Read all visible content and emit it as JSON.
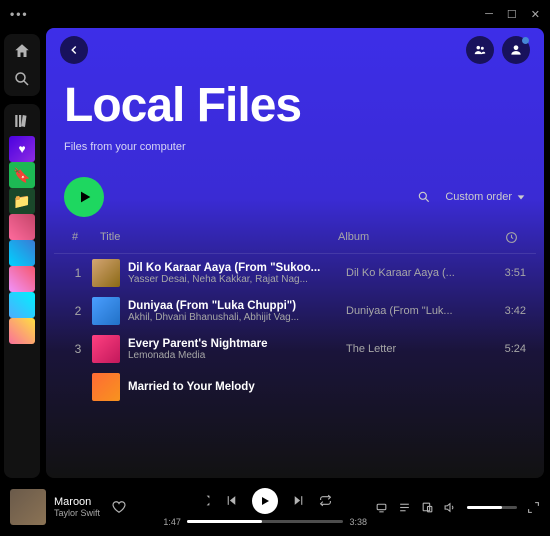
{
  "titlebar": {
    "dots": "•••"
  },
  "header": {
    "title": "Local Files",
    "subtitle": "Files from your computer"
  },
  "sort": {
    "label": "Custom order"
  },
  "columns": {
    "index": "#",
    "title": "Title",
    "album": "Album"
  },
  "tracks": [
    {
      "n": "1",
      "title": "Dil Ko Karaar Aaya (From \"Sukoo...",
      "artist": "Yasser Desai, Neha Kakkar, Rajat Nag...",
      "album": "Dil Ko Karaar Aaya (...",
      "dur": "3:51",
      "art": "linear-gradient(135deg,#d4a574,#8b6914)"
    },
    {
      "n": "2",
      "title": "Duniyaa (From \"Luka Chuppi\")",
      "artist": "Akhil, Dhvani Bhanushali, Abhijit Vag...",
      "album": "Duniyaa (From \"Luk...",
      "dur": "3:42",
      "art": "linear-gradient(135deg,#4a9eff,#2171c7)"
    },
    {
      "n": "3",
      "title": "Every Parent's Nightmare",
      "artist": "Lemonada Media",
      "album": "The Letter",
      "dur": "5:24",
      "art": "linear-gradient(135deg,#ff4081,#c2185b)"
    },
    {
      "n": "",
      "title": "Married to Your Melody",
      "artist": "",
      "album": "",
      "dur": "",
      "art": "linear-gradient(135deg,#ff6b35,#f7931e)"
    }
  ],
  "sidebar_items": [
    "linear-gradient(135deg,#4a00e0,#8e2de2)",
    "#1db954",
    "#1a472a",
    "linear-gradient(45deg,#ff6b9d,#c44569)",
    "linear-gradient(45deg,#00d2ff,#3a7bd5)",
    "linear-gradient(45deg,#f093fb,#f5576c)",
    "linear-gradient(45deg,#4facfe,#00f2fe)",
    "linear-gradient(45deg,#fa709a,#fee140)"
  ],
  "nowplaying": {
    "title": "Maroon",
    "artist": "Taylor Swift",
    "elapsed": "1:47",
    "total": "3:38",
    "pct": "48%"
  }
}
